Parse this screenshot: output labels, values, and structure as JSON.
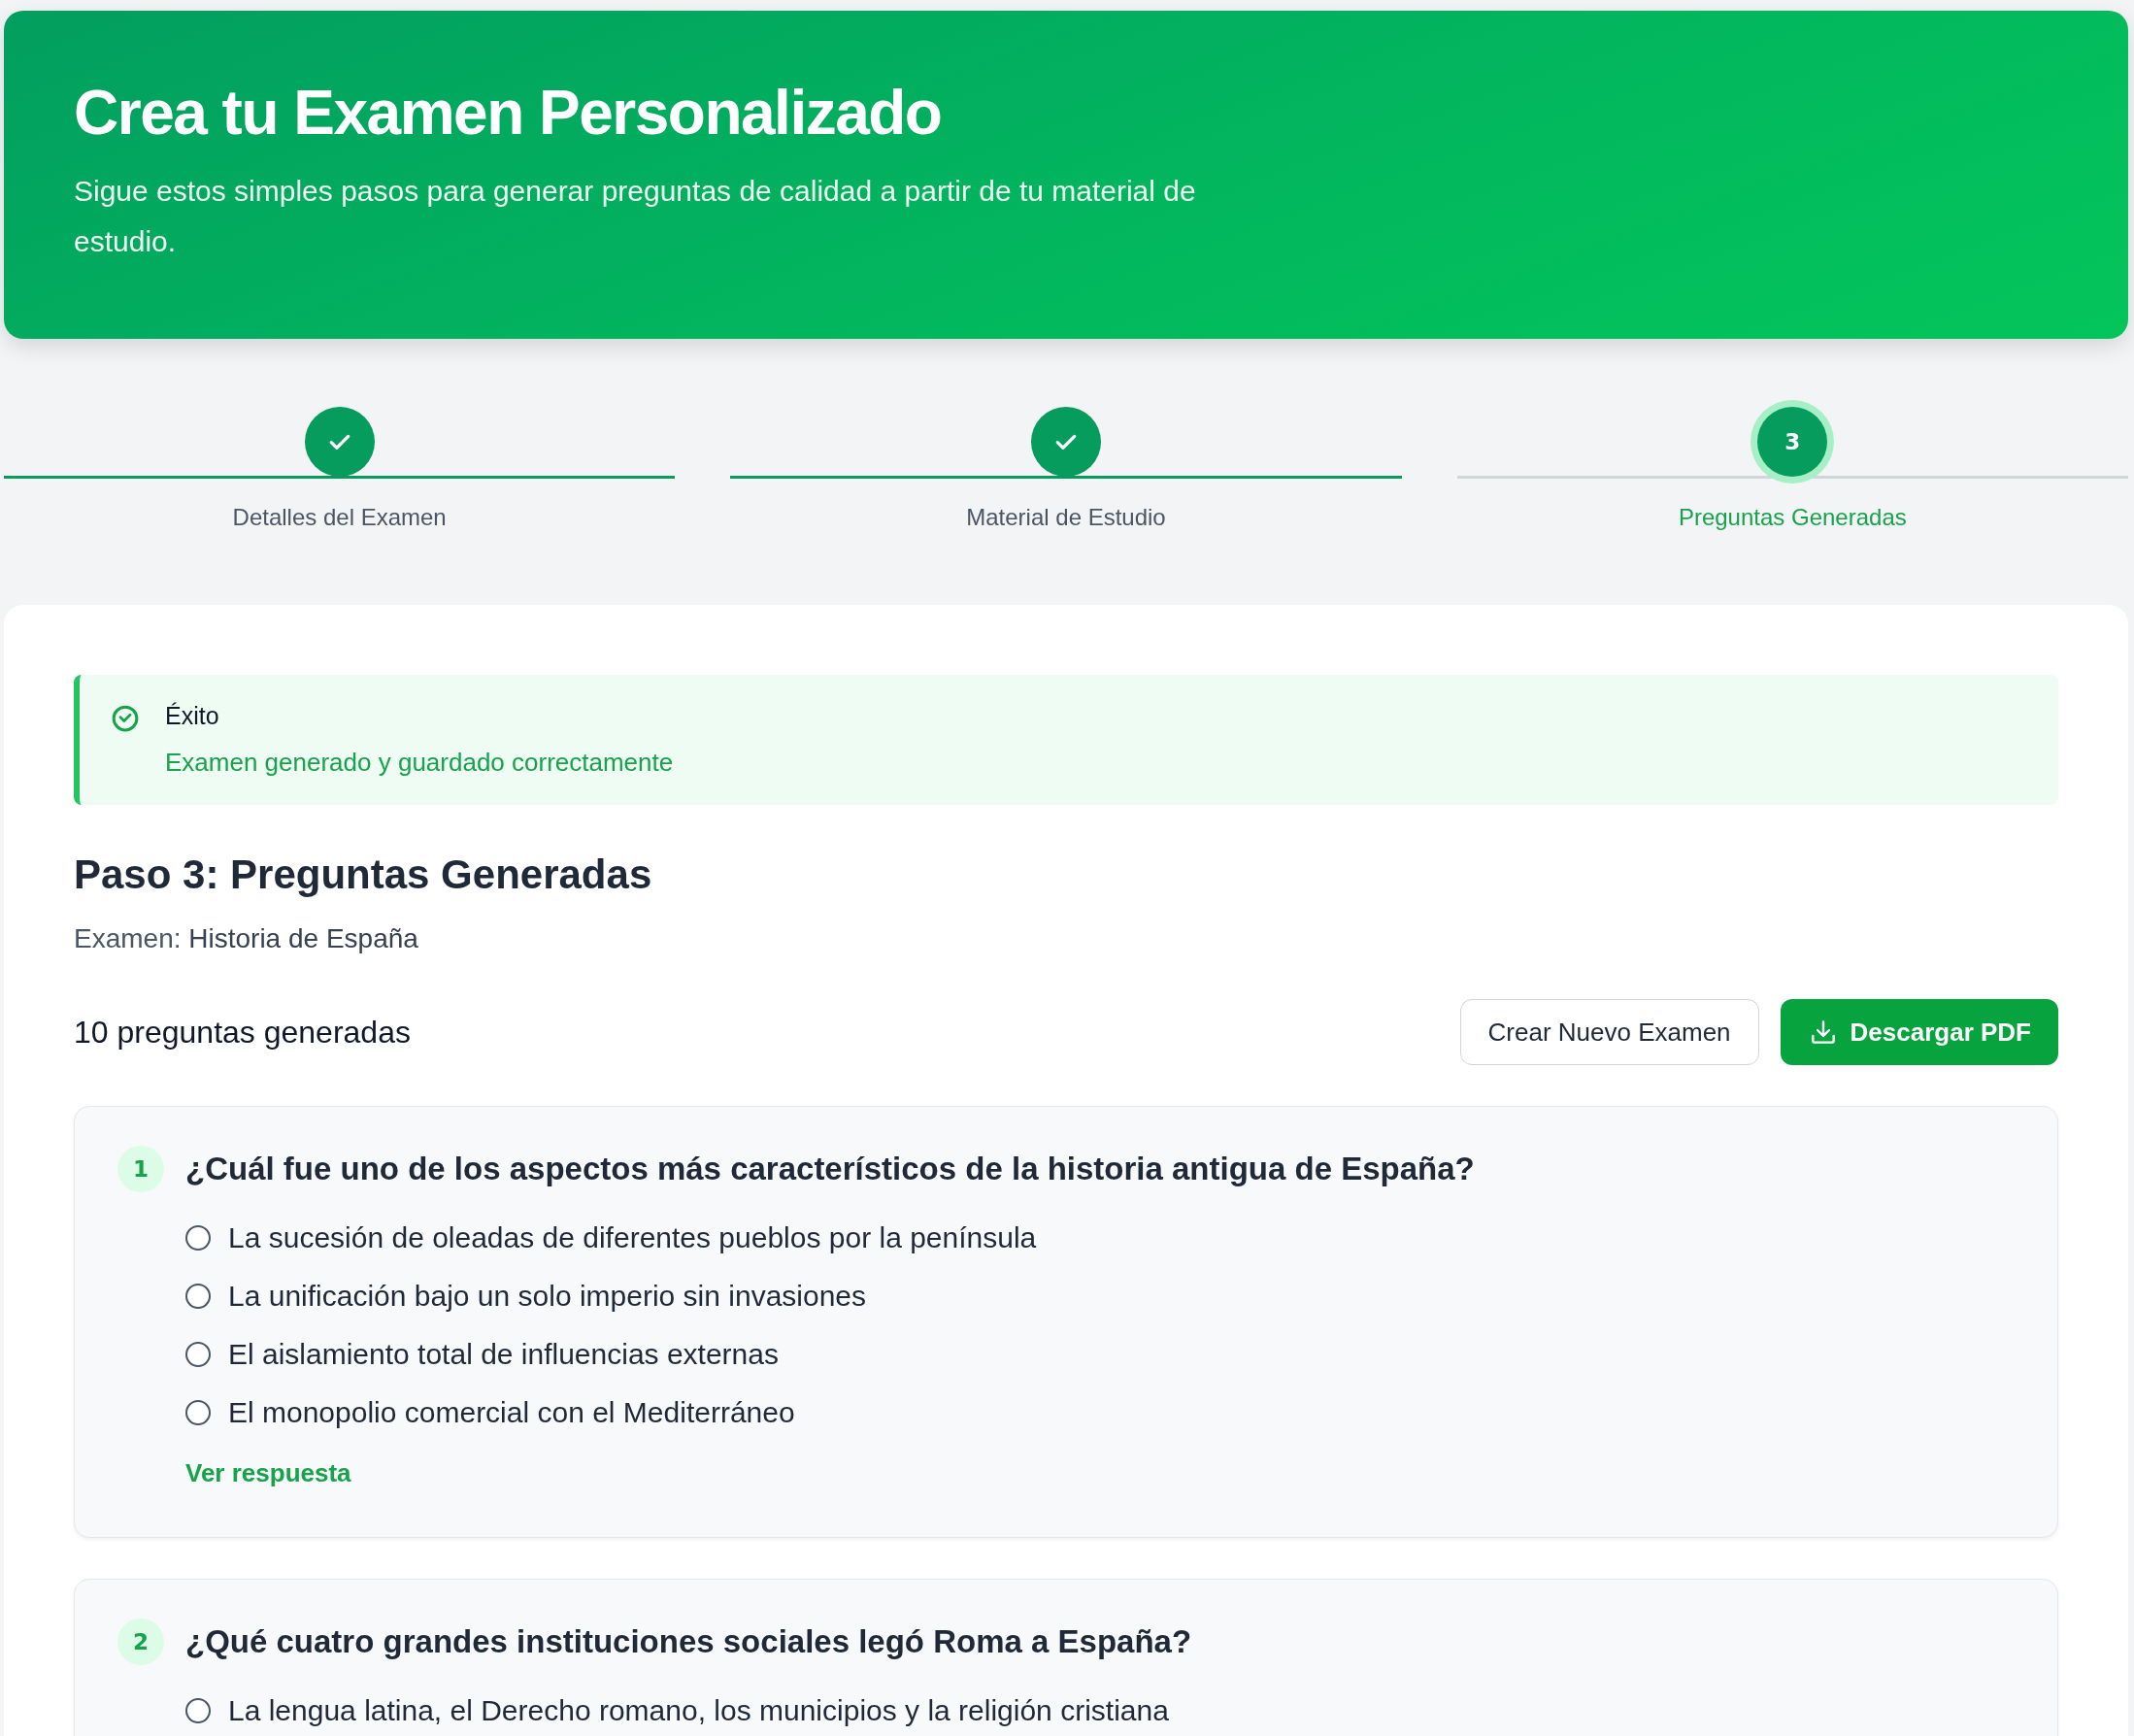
{
  "header": {
    "title": "Crea tu Examen Personalizado",
    "subtitle": "Sigue estos simples pasos para generar preguntas de calidad a partir de tu material de estudio."
  },
  "steps": [
    {
      "label": "Detalles del Examen",
      "completed": true,
      "selected": false
    },
    {
      "label": "Material de Estudio",
      "completed": true,
      "selected": false
    },
    {
      "number": "3",
      "label": "Preguntas Generadas",
      "completed": false,
      "selected": true
    }
  ],
  "alert": {
    "title": "Éxito",
    "message": "Examen generado y guardado correctamente"
  },
  "section": {
    "title": "Paso 3: Preguntas Generadas",
    "exam_label": "Examen:",
    "exam_name": "Historia de España"
  },
  "summary": "10 preguntas generadas",
  "buttons": [
    {
      "label": "Crear Nuevo Examen",
      "kind": "outline"
    },
    {
      "label": "Descargar PDF",
      "kind": "download"
    }
  ],
  "questions": [
    {
      "number": "1",
      "text": "¿Cuál fue uno de los aspectos más característicos de la historia antigua de España?",
      "options": [
        {
          "text": "La sucesión de oleadas de diferentes pueblos por la península",
          "selected": false
        },
        {
          "text": "La unificación bajo un solo imperio sin invasiones",
          "selected": false
        },
        {
          "text": "El aislamiento total de influencias externas",
          "selected": false
        },
        {
          "text": "El monopolio comercial con el Mediterráneo",
          "selected": false
        }
      ],
      "link": "Ver respuesta"
    },
    {
      "number": "2",
      "text": "¿Qué cuatro grandes instituciones sociales legó Roma a España?",
      "options": [
        {
          "text": "La lengua latina, el Derecho romano, los municipios y la religión cristiana",
          "selected": false
        }
      ]
    }
  ]
}
